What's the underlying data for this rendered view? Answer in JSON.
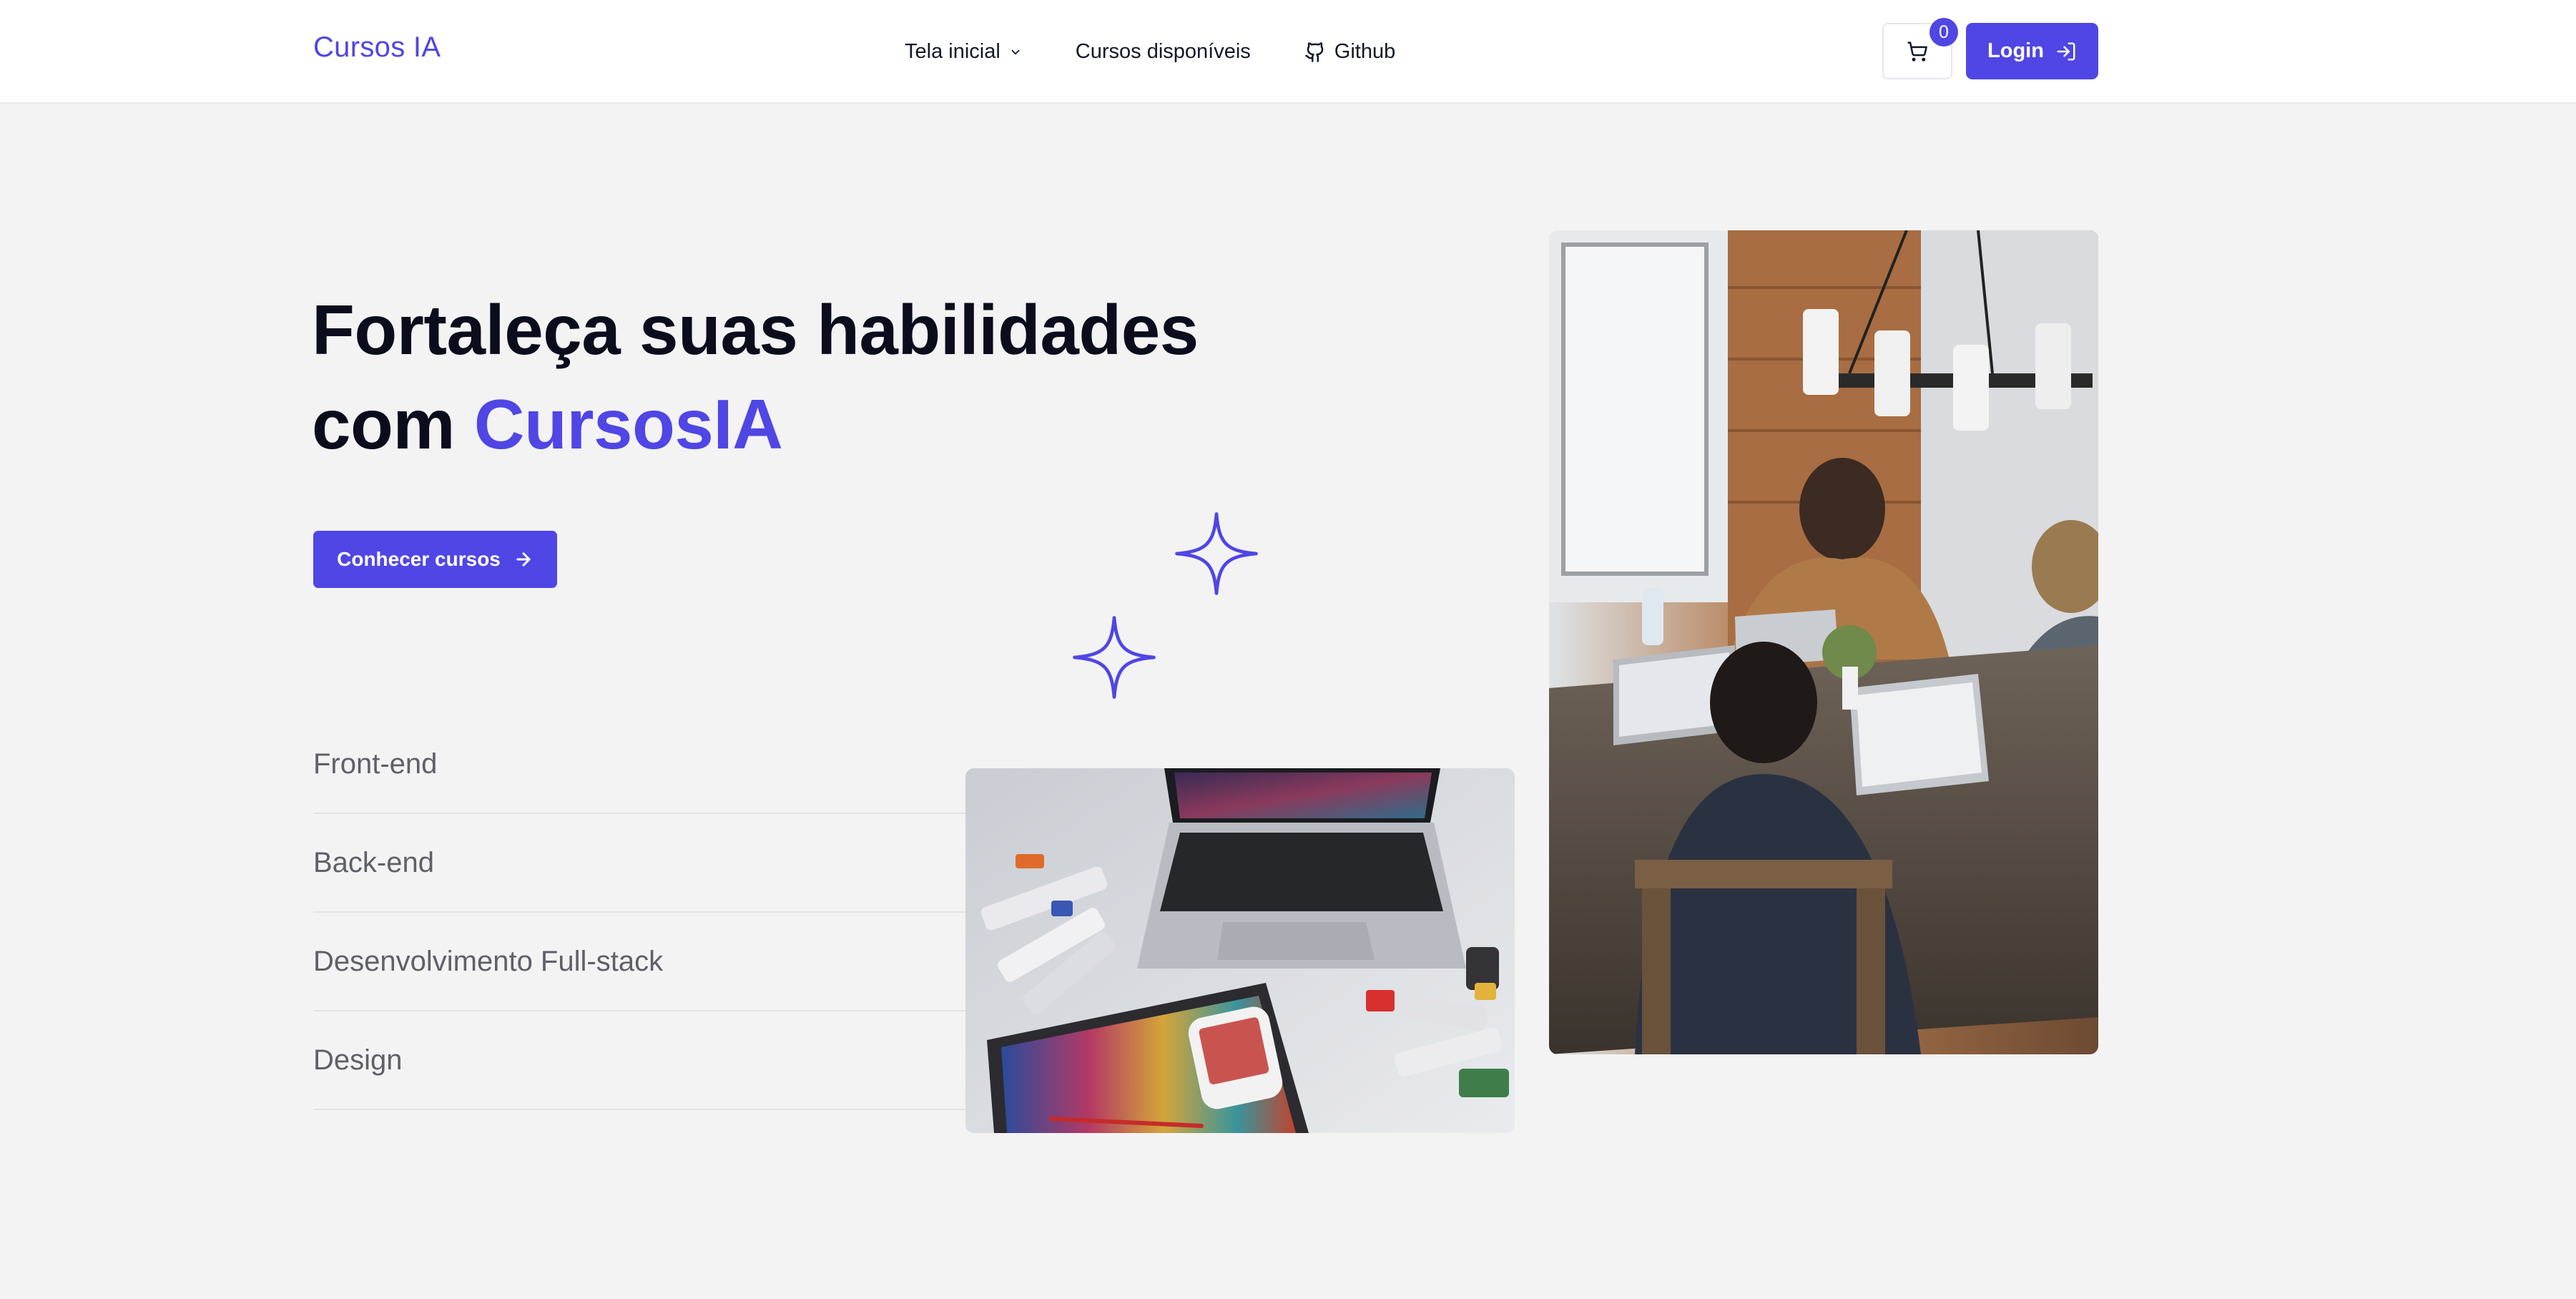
{
  "header": {
    "brand": "Cursos IA",
    "nav": [
      {
        "label": "Tela inicial",
        "icon": "chevron-down-icon"
      },
      {
        "label": "Cursos disponíveis"
      },
      {
        "label": "Github",
        "icon": "github-icon"
      }
    ],
    "cart": {
      "icon": "cart-icon",
      "count": "0"
    },
    "login": {
      "label": "Login",
      "icon": "login-icon"
    }
  },
  "hero": {
    "title_line1": "Fortaleça suas habilidades",
    "title_line2_prefix": "com ",
    "title_line2_accent": "CursosIA",
    "cta_label": "Conhecer cursos",
    "cta_icon": "arrow-right-icon"
  },
  "categories": [
    "Front-end",
    "Back-end",
    "Desenvolvimento Full-stack",
    "Design"
  ],
  "images": {
    "laptop_art": "laptop-with-paints-photo",
    "team_meeting": "team-working-on-laptops-photo"
  },
  "colors": {
    "accent": "#4f46e5",
    "background": "#f3f3f4",
    "header": "#ffffff",
    "heading": "#0b0d1c",
    "muted_text": "#5f6068"
  }
}
